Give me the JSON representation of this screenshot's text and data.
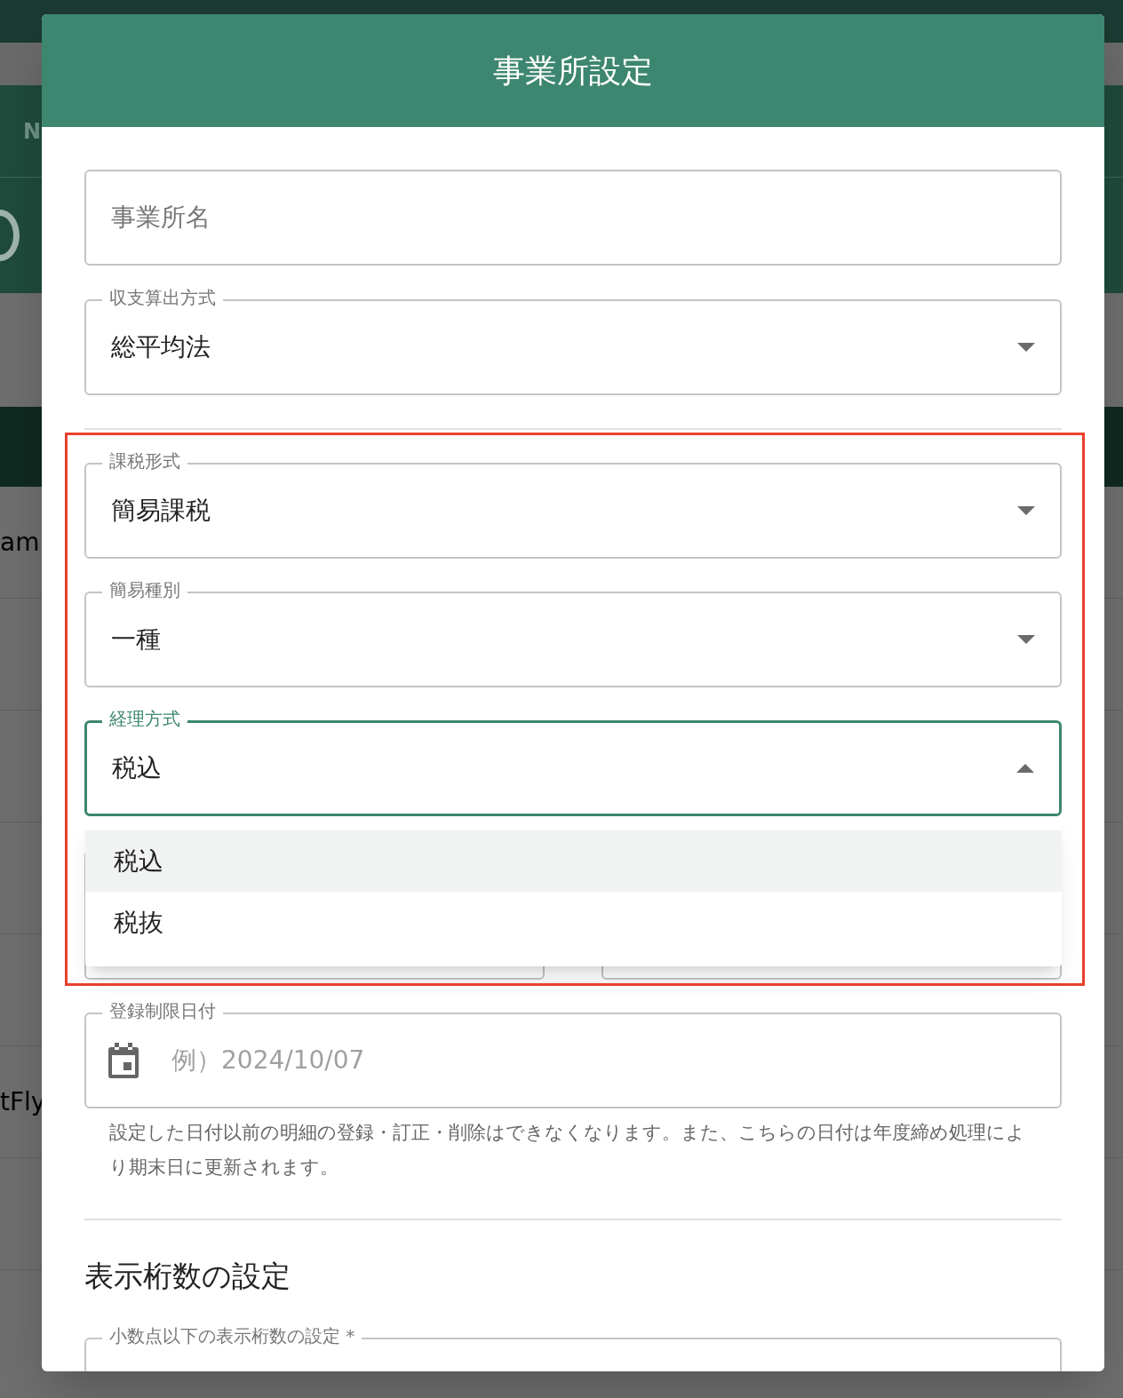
{
  "background": {
    "header_letter": "N",
    "rows": [
      "am",
      "",
      "",
      "",
      "",
      "tFly",
      ""
    ]
  },
  "dialog": {
    "title": "事業所設定",
    "top_fields": [
      {
        "kind": "text",
        "placeholder": "事業所名"
      },
      {
        "kind": "select",
        "label": "収支算出方式",
        "value": "総平均法",
        "focused": false,
        "expanded": false
      }
    ],
    "tax_fields": [
      {
        "kind": "select",
        "label": "課税形式",
        "value": "簡易課税",
        "focused": false,
        "expanded": false
      },
      {
        "kind": "select",
        "label": "簡易種別",
        "value": "一種",
        "focused": false,
        "expanded": false
      },
      {
        "kind": "select",
        "label": "経理方式",
        "value": "税込",
        "focused": true,
        "expanded": true
      }
    ],
    "menu": [
      {
        "label": "税込",
        "selected": true
      },
      {
        "label": "税抜",
        "selected": false
      }
    ],
    "date_field": {
      "label": "登録制限日付",
      "placeholder": "例）2024/10/07",
      "helper": "設定した日付以前の明細の登録・訂正・削除はできなくなります。また、こちらの日付は年度締め処理により期末日に更新されます。"
    },
    "section_title": "表示桁数の設定",
    "bottom_field": {
      "label": "小数点以下の表示桁数の設定 *"
    }
  }
}
